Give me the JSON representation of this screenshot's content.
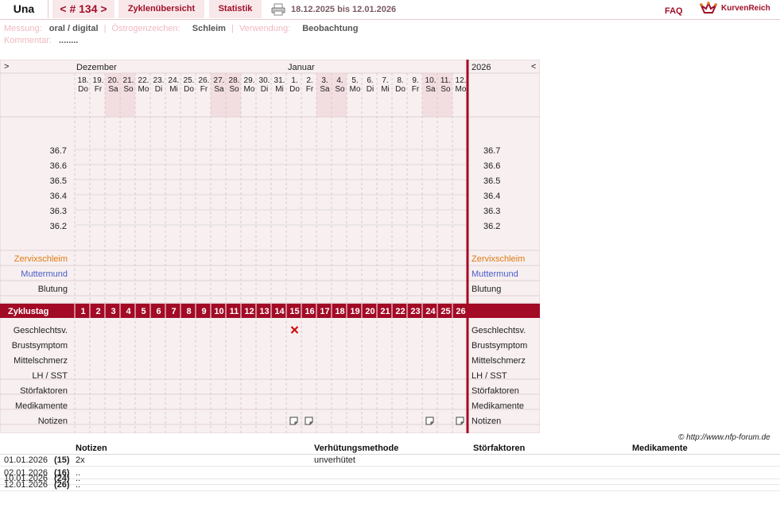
{
  "header": {
    "name": "Una",
    "nav_label": "< # 134 >",
    "tabs": [
      "Zyklenübersicht",
      "Statistik"
    ],
    "date_range": "18.12.2025 bis 12.01.2026",
    "faq": "FAQ",
    "logo": "KurvenReich",
    "print_icon": "printer-icon"
  },
  "meta": {
    "messung_label": "Messung:",
    "messung_value": "oral / digital",
    "oestrogen_label": "Östrogenzeichen:",
    "oestrogen_value": "Schleim",
    "verwendung_label": "Verwendung:",
    "verwendung_value": "Beobachtung",
    "kommentar_label": "Kommentar:",
    "kommentar_value": "........"
  },
  "chart": {
    "nav_left": ">",
    "nav_right": "<",
    "month1": "Dezember",
    "month2": "Januar",
    "year": "2026",
    "days": [
      {
        "d": "18.",
        "w": "Do",
        "we": false
      },
      {
        "d": "19.",
        "w": "Fr",
        "we": false
      },
      {
        "d": "20.",
        "w": "Sa",
        "we": true
      },
      {
        "d": "21.",
        "w": "So",
        "we": true
      },
      {
        "d": "22.",
        "w": "Mo",
        "we": false
      },
      {
        "d": "23.",
        "w": "Di",
        "we": false
      },
      {
        "d": "24.",
        "w": "Mi",
        "we": false
      },
      {
        "d": "25.",
        "w": "Do",
        "we": false
      },
      {
        "d": "26.",
        "w": "Fr",
        "we": false
      },
      {
        "d": "27.",
        "w": "Sa",
        "we": true
      },
      {
        "d": "28.",
        "w": "So",
        "we": true
      },
      {
        "d": "29.",
        "w": "Mo",
        "we": false
      },
      {
        "d": "30.",
        "w": "Di",
        "we": false
      },
      {
        "d": "31.",
        "w": "Mi",
        "we": false
      },
      {
        "d": "1.",
        "w": "Do",
        "we": false
      },
      {
        "d": "2.",
        "w": "Fr",
        "we": false
      },
      {
        "d": "3.",
        "w": "Sa",
        "we": true
      },
      {
        "d": "4.",
        "w": "So",
        "we": true
      },
      {
        "d": "5.",
        "w": "Mo",
        "we": false
      },
      {
        "d": "6.",
        "w": "Di",
        "we": false
      },
      {
        "d": "7.",
        "w": "Mi",
        "we": false
      },
      {
        "d": "8.",
        "w": "Do",
        "we": false
      },
      {
        "d": "9.",
        "w": "Fr",
        "we": false
      },
      {
        "d": "10.",
        "w": "Sa",
        "we": true
      },
      {
        "d": "11.",
        "w": "So",
        "we": true
      },
      {
        "d": "12.",
        "w": "Mo",
        "we": false
      }
    ],
    "temps": [
      "36.7",
      "36.6",
      "36.5",
      "36.4",
      "36.3",
      "36.2"
    ],
    "rows_top": [
      {
        "label": "Zervixschleim",
        "color": "#e07a10"
      },
      {
        "label": "Muttermund",
        "color": "#4a5ec8"
      },
      {
        "label": "Blutung",
        "color": "#222222"
      }
    ],
    "zyklustag_label": "Zyklustag",
    "cycle_days": [
      "1",
      "2",
      "3",
      "4",
      "5",
      "6",
      "7",
      "8",
      "9",
      "10",
      "11",
      "12",
      "13",
      "14",
      "15",
      "16",
      "17",
      "18",
      "19",
      "20",
      "21",
      "22",
      "23",
      "24",
      "25",
      "26"
    ],
    "rows_bottom": [
      "Geschlechtsv.",
      "Brustsymptom",
      "Mittelschmerz",
      "LH / SST",
      "Störfaktoren",
      "Medikamente",
      "Notizen"
    ],
    "intercourse_day_index": 14,
    "notes_day_indices": [
      14,
      15,
      23,
      25
    ],
    "accent": "#a20a25",
    "weekend_bg": "#f2dde0"
  },
  "copyright": "© http://www.nfp-forum.de",
  "notes_table": {
    "headers": [
      "Notizen",
      "Verhütungsmethode",
      "Störfaktoren",
      "Medikamente"
    ],
    "rows": [
      {
        "date": "01.01.2026",
        "day": "(15)",
        "note": "2x",
        "method": "unverhütet"
      },
      {
        "date": "02.01.2026",
        "day": "(16)",
        "note": "..",
        "method": ""
      },
      {
        "date": "10.01.2026",
        "day": "(24)",
        "note": "..",
        "method": ""
      },
      {
        "date": "12.01.2026",
        "day": "(26)",
        "note": "..",
        "method": ""
      }
    ]
  }
}
